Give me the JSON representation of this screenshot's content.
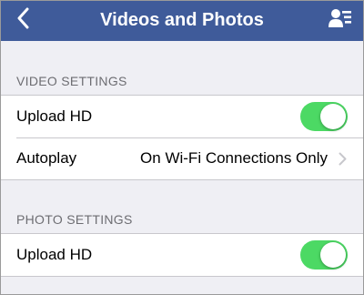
{
  "navbar": {
    "title": "Videos and Photos",
    "back_icon": "chevron-left-icon",
    "profile_icon": "contact-list-icon",
    "background": "#3f5b9a"
  },
  "video_settings": {
    "header": "VIDEO SETTINGS",
    "upload_hd": {
      "label": "Upload HD",
      "enabled": true
    },
    "autoplay": {
      "label": "Autoplay",
      "value": "On Wi-Fi Connections Only"
    }
  },
  "photo_settings": {
    "header": "PHOTO SETTINGS",
    "upload_hd": {
      "label": "Upload HD",
      "enabled": true
    }
  },
  "colors": {
    "toggle_on": "#4cd964",
    "page_background": "#efeff4"
  }
}
